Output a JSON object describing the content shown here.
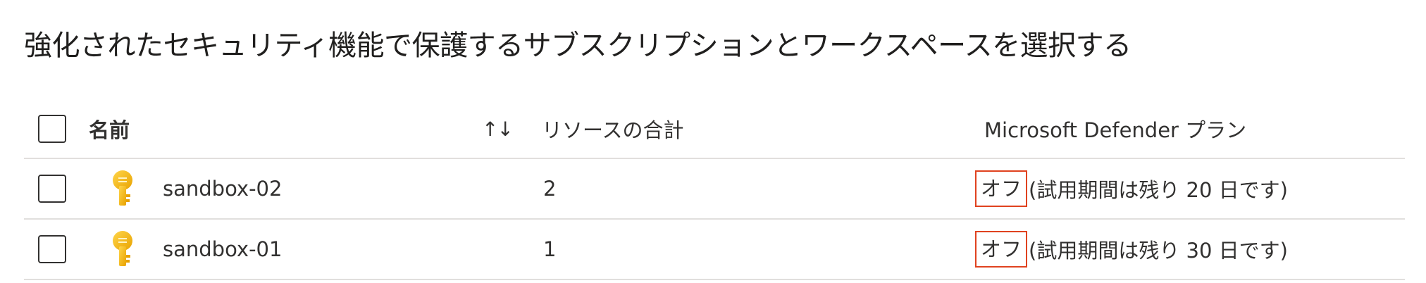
{
  "page": {
    "title": "強化されたセキュリティ機能で保護するサブスクリプションとワークスペースを選択する"
  },
  "table": {
    "columns": {
      "name": "名前",
      "sort_icon": "↑↓",
      "resources_total": "リソースの合計",
      "defender_plan": "Microsoft Defender プラン"
    },
    "rows": [
      {
        "name": "sandbox-02",
        "resources": "2",
        "status": "オフ",
        "trial": "(試用期間は残り 20 日です)"
      },
      {
        "name": "sandbox-01",
        "resources": "1",
        "status": "オフ",
        "trial": "(試用期間は残り 30 日です)"
      }
    ]
  },
  "colors": {
    "status_highlight": "#e0421f",
    "key_icon": "#f2b90f",
    "divider": "#e1dfdd"
  },
  "icons": {
    "row_icon": "key-icon"
  }
}
